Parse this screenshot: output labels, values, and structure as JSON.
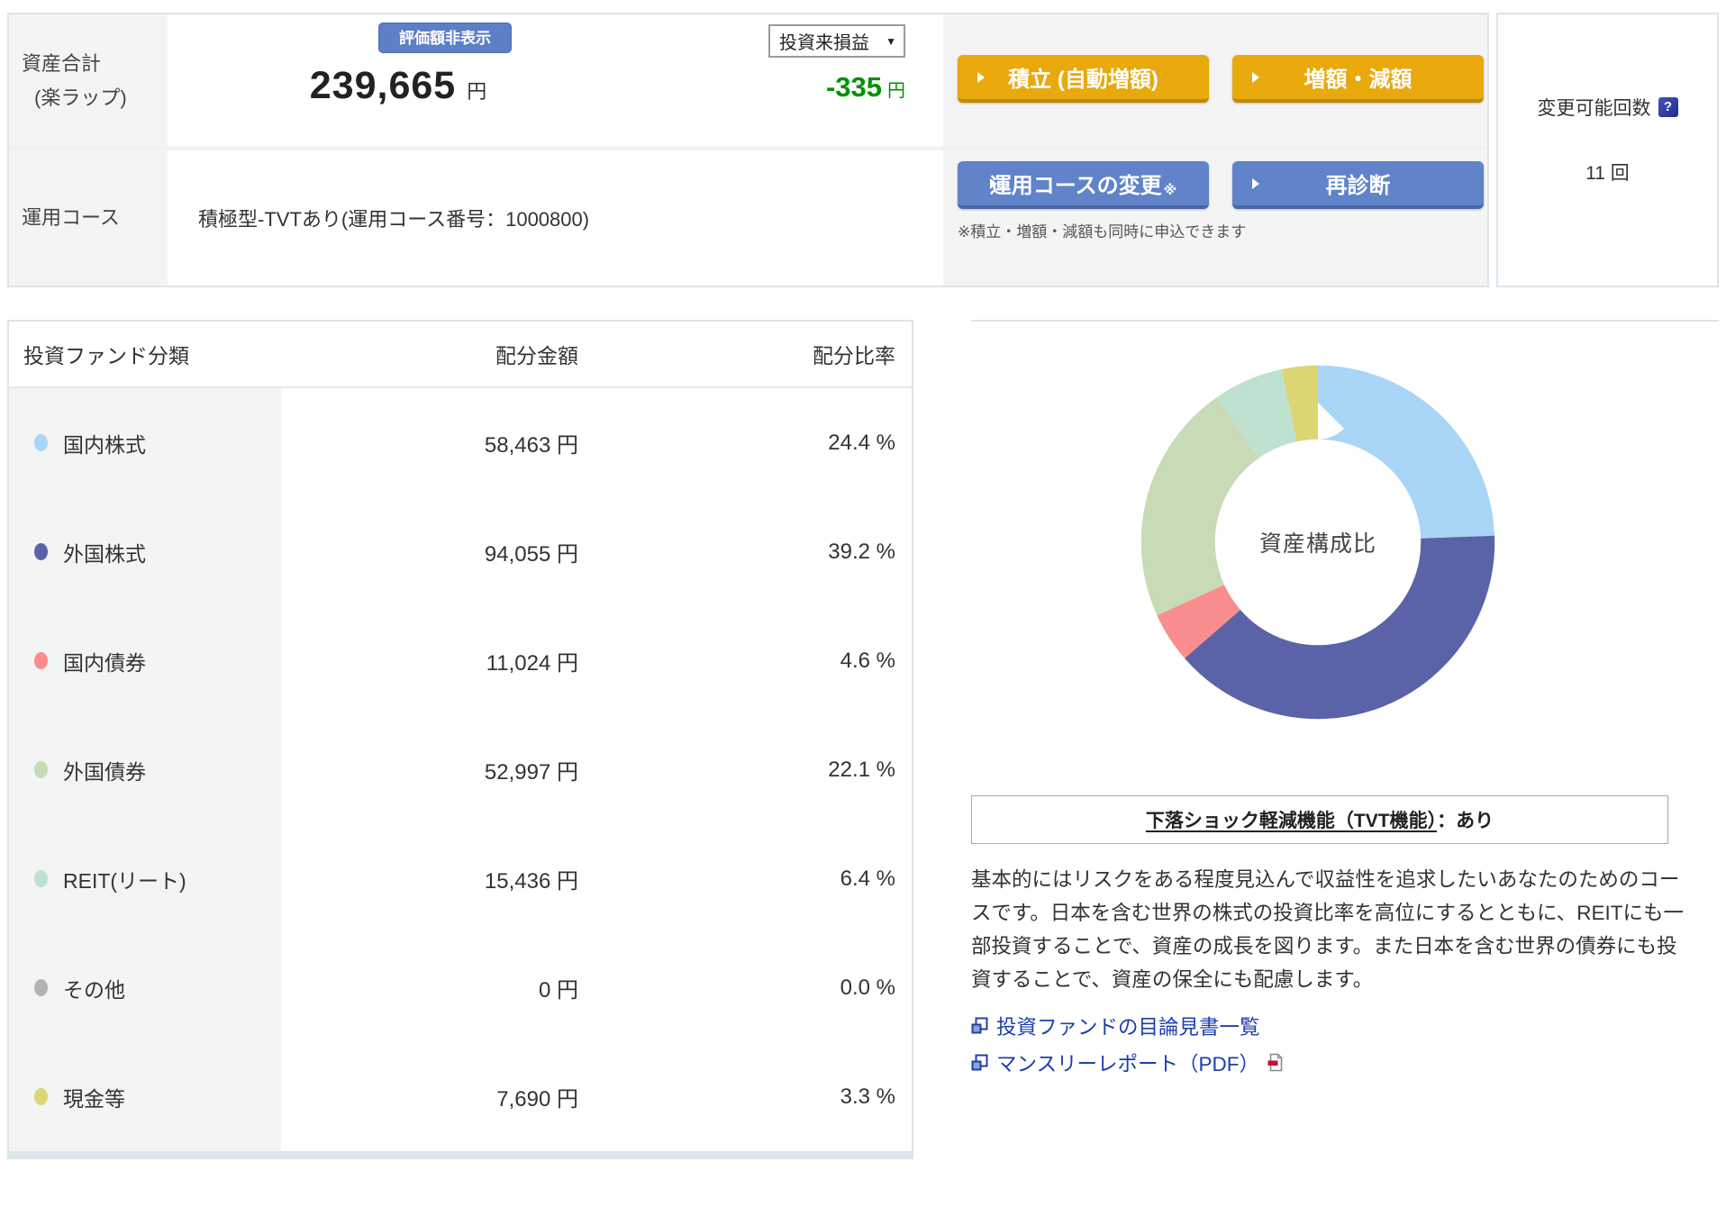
{
  "header": {
    "asset_label_line1": "資産合計",
    "asset_label_line2": "(楽ラップ)",
    "hide_value_button": "評価額非表示",
    "total_amount": "239,665",
    "total_amount_unit": "円",
    "pl_dropdown_value": "投資来損益",
    "pl_value": "-335",
    "pl_unit": "円",
    "tsumitate_button": "積立 (自動増額)",
    "zogaku_button": "増額・減額",
    "course_row_label": "運用コース",
    "course_value": "積極型-TVTあり(運用コース番号：1000800)",
    "course_change_button": "運用コースの変更",
    "course_change_mark": "※",
    "rediagnosis_button": "再診断",
    "simultaneous_note": "※積立・増額・減額も同時に申込できます",
    "change_count_label": "変更可能回数",
    "change_count_help_icon": "?",
    "change_count_value": "11 回"
  },
  "table": {
    "headers": [
      "投資ファンド分類",
      "配分金額",
      "配分比率"
    ],
    "rows": [
      {
        "label": "国内株式",
        "amount": "58,463 円",
        "ratio": "24.4 %",
        "color": "#a9d5f6"
      },
      {
        "label": "外国株式",
        "amount": "94,055 円",
        "ratio": "39.2 %",
        "color": "#5a63a7"
      },
      {
        "label": "国内債券",
        "amount": "11,024 円",
        "ratio": "4.6 %",
        "color": "#fa8d8d"
      },
      {
        "label": "外国債券",
        "amount": "52,997 円",
        "ratio": "22.1 %",
        "color": "#c8dab6"
      },
      {
        "label": "REIT(リート)",
        "amount": "15,436 円",
        "ratio": "6.4 %",
        "color": "#bfe1cf"
      },
      {
        "label": "その他",
        "amount": "0 円",
        "ratio": "0.0 %",
        "color": "#b3b3b3"
      },
      {
        "label": "現金等",
        "amount": "7,690 円",
        "ratio": "3.3 %",
        "color": "#dbd573"
      }
    ]
  },
  "chart_data": {
    "type": "pie",
    "donut": true,
    "title": "資産構成比",
    "labels": [
      "国内株式",
      "外国株式",
      "国内債券",
      "外国債券",
      "REIT(リート)",
      "その他",
      "現金等"
    ],
    "values": [
      24.4,
      39.2,
      4.6,
      22.1,
      6.4,
      0.0,
      3.3
    ],
    "colors": [
      "#a9d5f6",
      "#5a63a7",
      "#fa8d8d",
      "#c8dab6",
      "#bfe1cf",
      "#b3b3b3",
      "#dbd573"
    ],
    "start_angle_deg": 0,
    "direction": "clockwise",
    "legend_position": "none"
  },
  "tvt_box": {
    "underlined": "下落ショック軽減機能（TVT機能）",
    "suffix": "：あり"
  },
  "description": "基本的にはリスクをある程度見込んで収益性を追求したいあなたのためのコースです。日本を含む世界の株式の投資比率を高位にするとともに、REITにも一部投資することで、資産の成長を図ります。また日本を含む世界の債券にも投資することで、資産の保全にも配慮します。",
  "links": [
    {
      "label": "投資ファンドの目論見書一覧",
      "pdf": false
    },
    {
      "label": "マンスリーレポート（PDF）",
      "pdf": true
    }
  ],
  "colors": {
    "accent_orange": "#e9a90c",
    "accent_blue": "#6083c9",
    "hide_button_blue": "#5c7fc6",
    "pl_green": "#009100",
    "link_blue": "#1b3fae"
  }
}
